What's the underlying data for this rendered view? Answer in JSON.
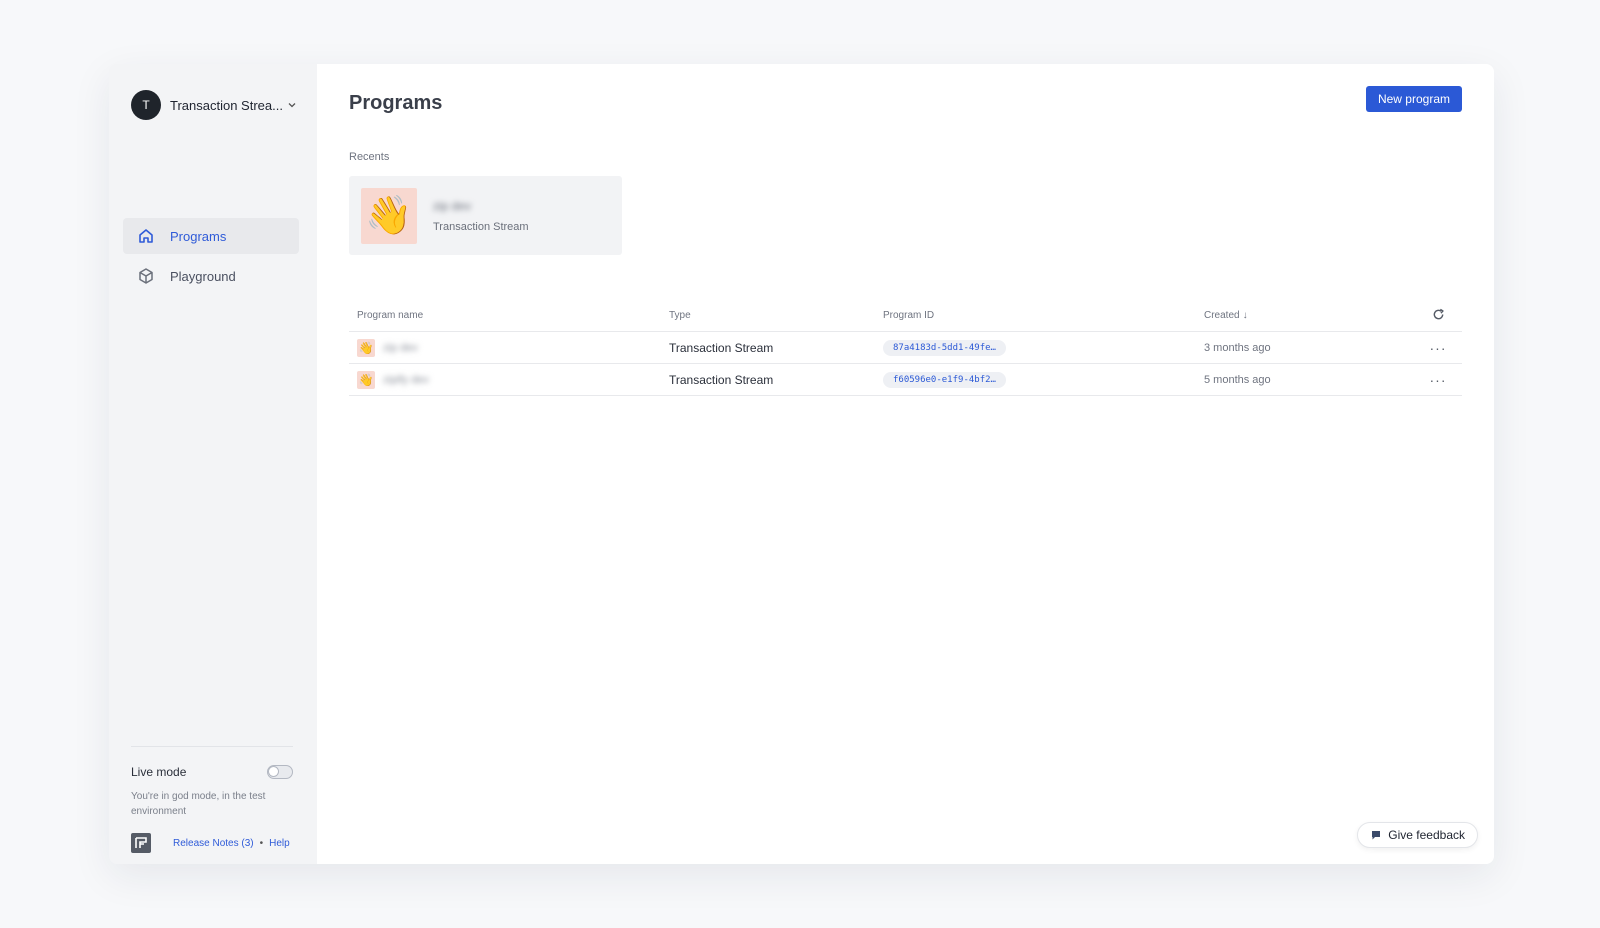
{
  "workspace": {
    "avatar_letter": "T",
    "name": "Transaction Strea..."
  },
  "nav": {
    "items": [
      {
        "label": "Programs",
        "icon": "home-icon",
        "active": true
      },
      {
        "label": "Playground",
        "icon": "cube-icon",
        "active": false
      }
    ]
  },
  "footer": {
    "live_mode_label": "Live mode",
    "live_mode_on": false,
    "description": "You're in god mode, in the test environment",
    "release_notes": "Release Notes (3)",
    "separator": "•",
    "help": "Help"
  },
  "header": {
    "title": "Programs",
    "new_button": "New program"
  },
  "recents": {
    "label": "Recents",
    "items": [
      {
        "emoji": "👋",
        "name": "zip dev",
        "type": "Transaction Stream"
      }
    ]
  },
  "table": {
    "headers": {
      "name": "Program name",
      "type": "Type",
      "id": "Program ID",
      "created": "Created",
      "sort_arrow": "↓"
    },
    "rows": [
      {
        "emoji": "👋",
        "name": "zip dev",
        "type": "Transaction Stream",
        "program_id": "87a4183d-5dd1-49fe…",
        "created": "3 months ago"
      },
      {
        "emoji": "👋",
        "name": "zipify dev",
        "type": "Transaction Stream",
        "program_id": "f60596e0-e1f9-4bf2…",
        "created": "5 months ago"
      }
    ]
  },
  "feedback": {
    "label": "Give feedback"
  },
  "colors": {
    "accent": "#2b59d6",
    "active_bg": "#e8e9ec",
    "emoji_bg": "#f8d8d0"
  }
}
